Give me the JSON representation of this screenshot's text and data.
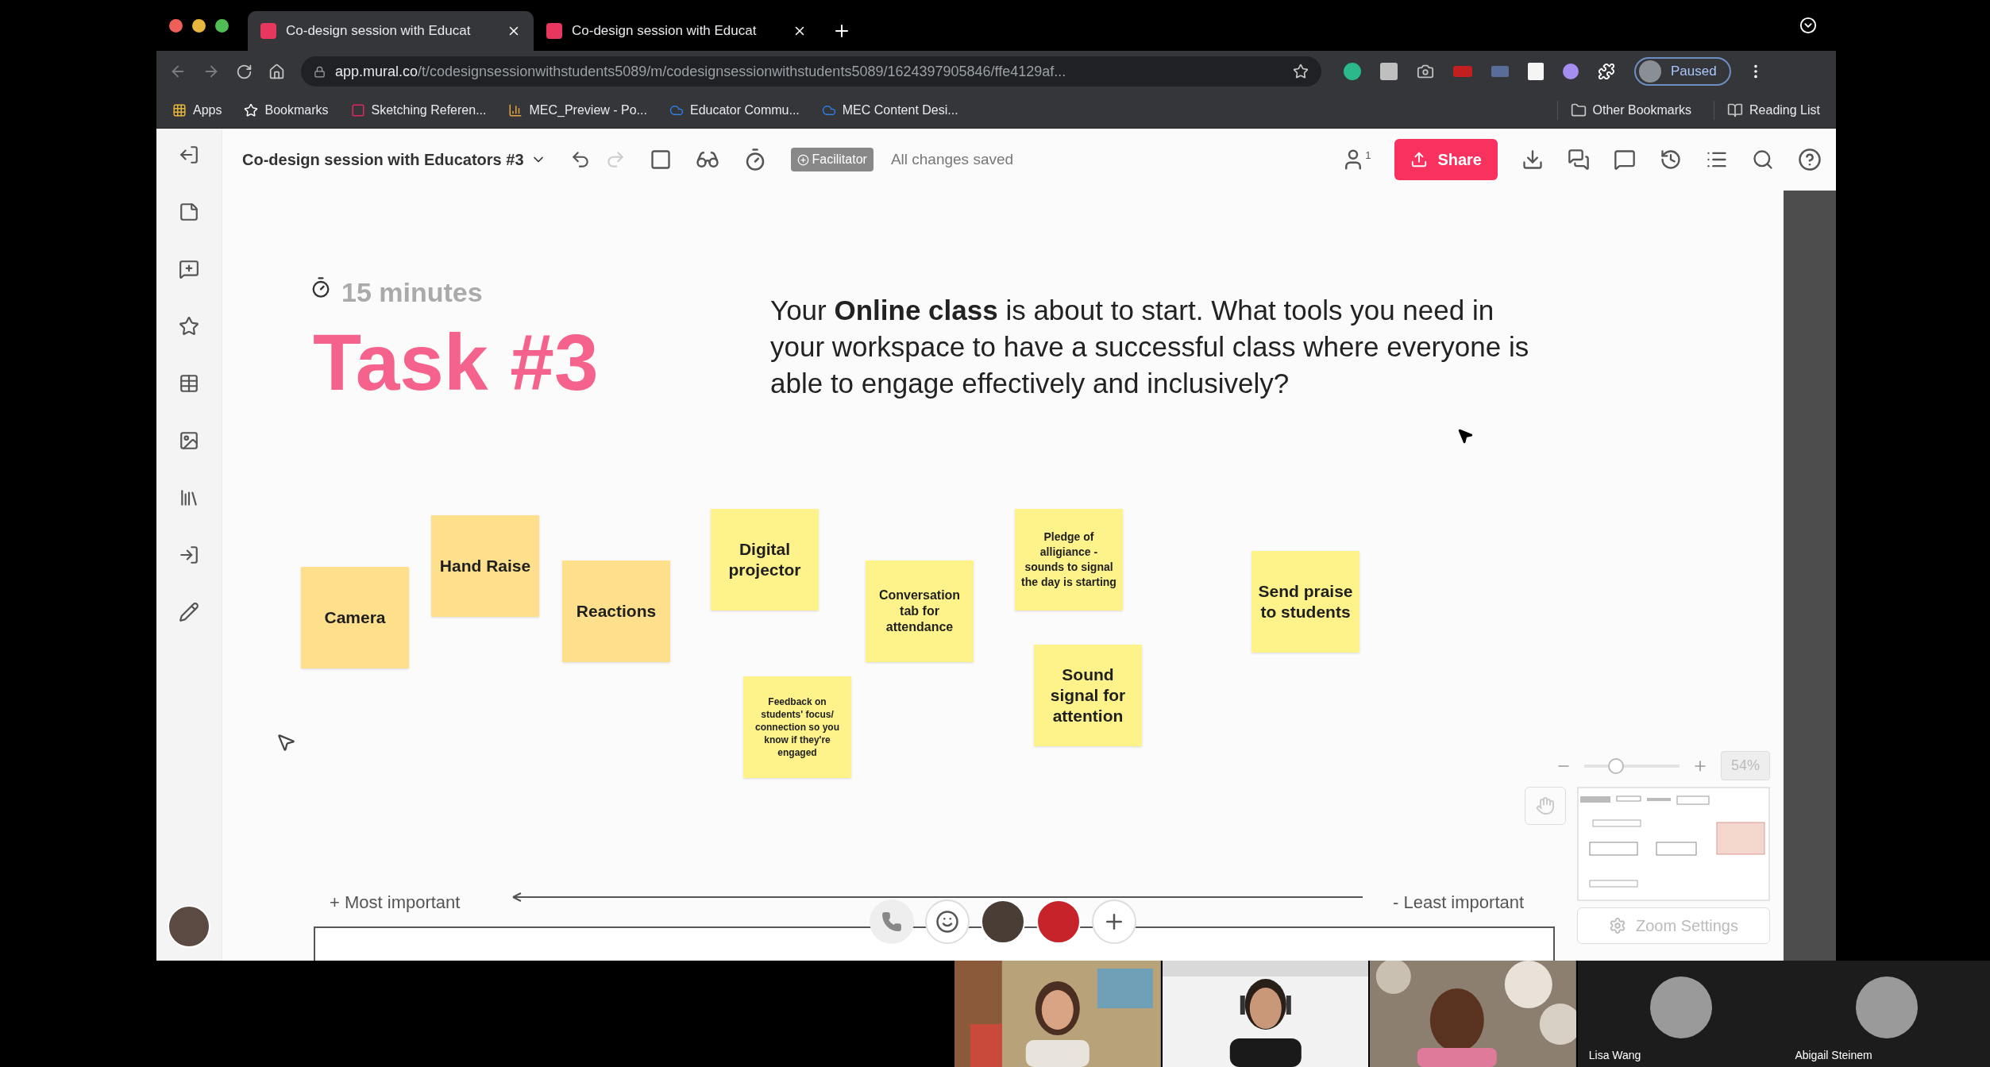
{
  "browser": {
    "tabs": [
      {
        "title": "Co-design session with Educat",
        "selected": true
      },
      {
        "title": "Co-design session with Educat",
        "selected": false
      }
    ],
    "url": {
      "host": "app.mural.co",
      "path": "/t/codesignsessionwithstudents5089/m/codesignsessionwithstudents5089/1624397905846/ffe4129af..."
    },
    "profile_status": "Paused",
    "bookmarks": [
      {
        "label": "Apps",
        "kind": "apps"
      },
      {
        "label": "Bookmarks",
        "kind": "star"
      },
      {
        "label": "Sketching Referen...",
        "kind": "pin"
      },
      {
        "label": "MEC_Preview - Po...",
        "kind": "chart"
      },
      {
        "label": "Educator Commu...",
        "kind": "cloud"
      },
      {
        "label": "MEC Content Desi...",
        "kind": "cloud"
      }
    ],
    "other_bookmarks": "Other Bookmarks",
    "reading_list": "Reading List"
  },
  "toolbar": {
    "board_title": "Co-design session with Educators #3",
    "role_badge": "Facilitator",
    "save_status": "All changes saved",
    "collaborators": "1",
    "share": "Share"
  },
  "canvas": {
    "timer": "15 minutes",
    "heading": "Task #3",
    "prompt": "Your **Online class** is about to start. What tools you need in your workspace to have a successful class where everyone is able to engage effectively and inclusively?",
    "stickies": [
      {
        "text": "Camera",
        "kind": "large"
      },
      {
        "text": "Hand Raise",
        "kind": "large"
      },
      {
        "text": "Reactions",
        "kind": "large"
      },
      {
        "text": "Digital projector",
        "kind": "large"
      },
      {
        "text": "Conversation tab for attendance",
        "kind": "medium"
      },
      {
        "text": "Pledge of alligiance - sounds to signal the day is starting",
        "kind": "small"
      },
      {
        "text": "Feedback on students' focus/ connection so you know if they're engaged",
        "kind": "tiny"
      },
      {
        "text": "Sound signal for attention",
        "kind": "large"
      },
      {
        "text": "Send praise to students",
        "kind": "large"
      }
    ],
    "scale": {
      "start": "+ Most important",
      "end": "- Least important"
    }
  },
  "zoom": {
    "level": 0.3,
    "percent": "54%",
    "settings": "Zoom Settings"
  },
  "participants": [
    {
      "kind": "video"
    },
    {
      "kind": "video"
    },
    {
      "kind": "video"
    },
    {
      "kind": "avatar",
      "name": "Lisa Wang"
    },
    {
      "kind": "avatar",
      "name": "Abigail Steinem"
    }
  ]
}
